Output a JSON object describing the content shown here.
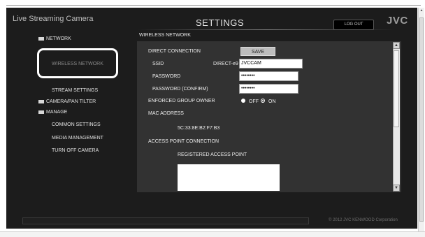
{
  "header": {
    "app_title": "Live Streaming Camera",
    "settings_title": "SETTINGS",
    "logout_label": "LOG OUT",
    "brand": "JVC"
  },
  "sidebar": {
    "network_label": "NETWORK",
    "wireless_network_label": "WIRELESS NETWORK",
    "stream_settings_label": "STREAM SETTINGS",
    "camera_pan_tilter_label": "CAMERA/PAN TILTER",
    "manage_label": "MANAGE",
    "common_settings_label": "COMMON SETTINGS",
    "media_management_label": "MEDIA MANAGEMENT",
    "turn_off_camera_label": "TURN OFF CAMERA"
  },
  "panel": {
    "heading": "WIRELESS NETWORK",
    "direct_connection_label": "DIRECT CONNECTION",
    "save_label": "SAVE",
    "ssid_label": "SSID",
    "ssid_prefix": "DIRECT-e9",
    "ssid_value": "JVCCAM",
    "password_label": "PASSWORD",
    "password_value": "••••••••",
    "password_confirm_label": "PASSWORD (CONFIRM)",
    "password_confirm_value": "••••••••",
    "enforced_group_owner_label": "ENFORCED GROUP OWNER",
    "off_label": "OFF",
    "on_label": "ON",
    "enforced_group_owner_selected": "ON",
    "mac_address_label": "MAC ADDRESS",
    "mac_address_value": "5C:33:8E:B2:F7:B3",
    "access_point_connection_label": "ACCESS POINT CONNECTION",
    "registered_access_point_label": "REGISTERED ACCESS POINT"
  },
  "footer": {
    "copyright": "© 2012 JVC KENWOOD Corporation"
  }
}
